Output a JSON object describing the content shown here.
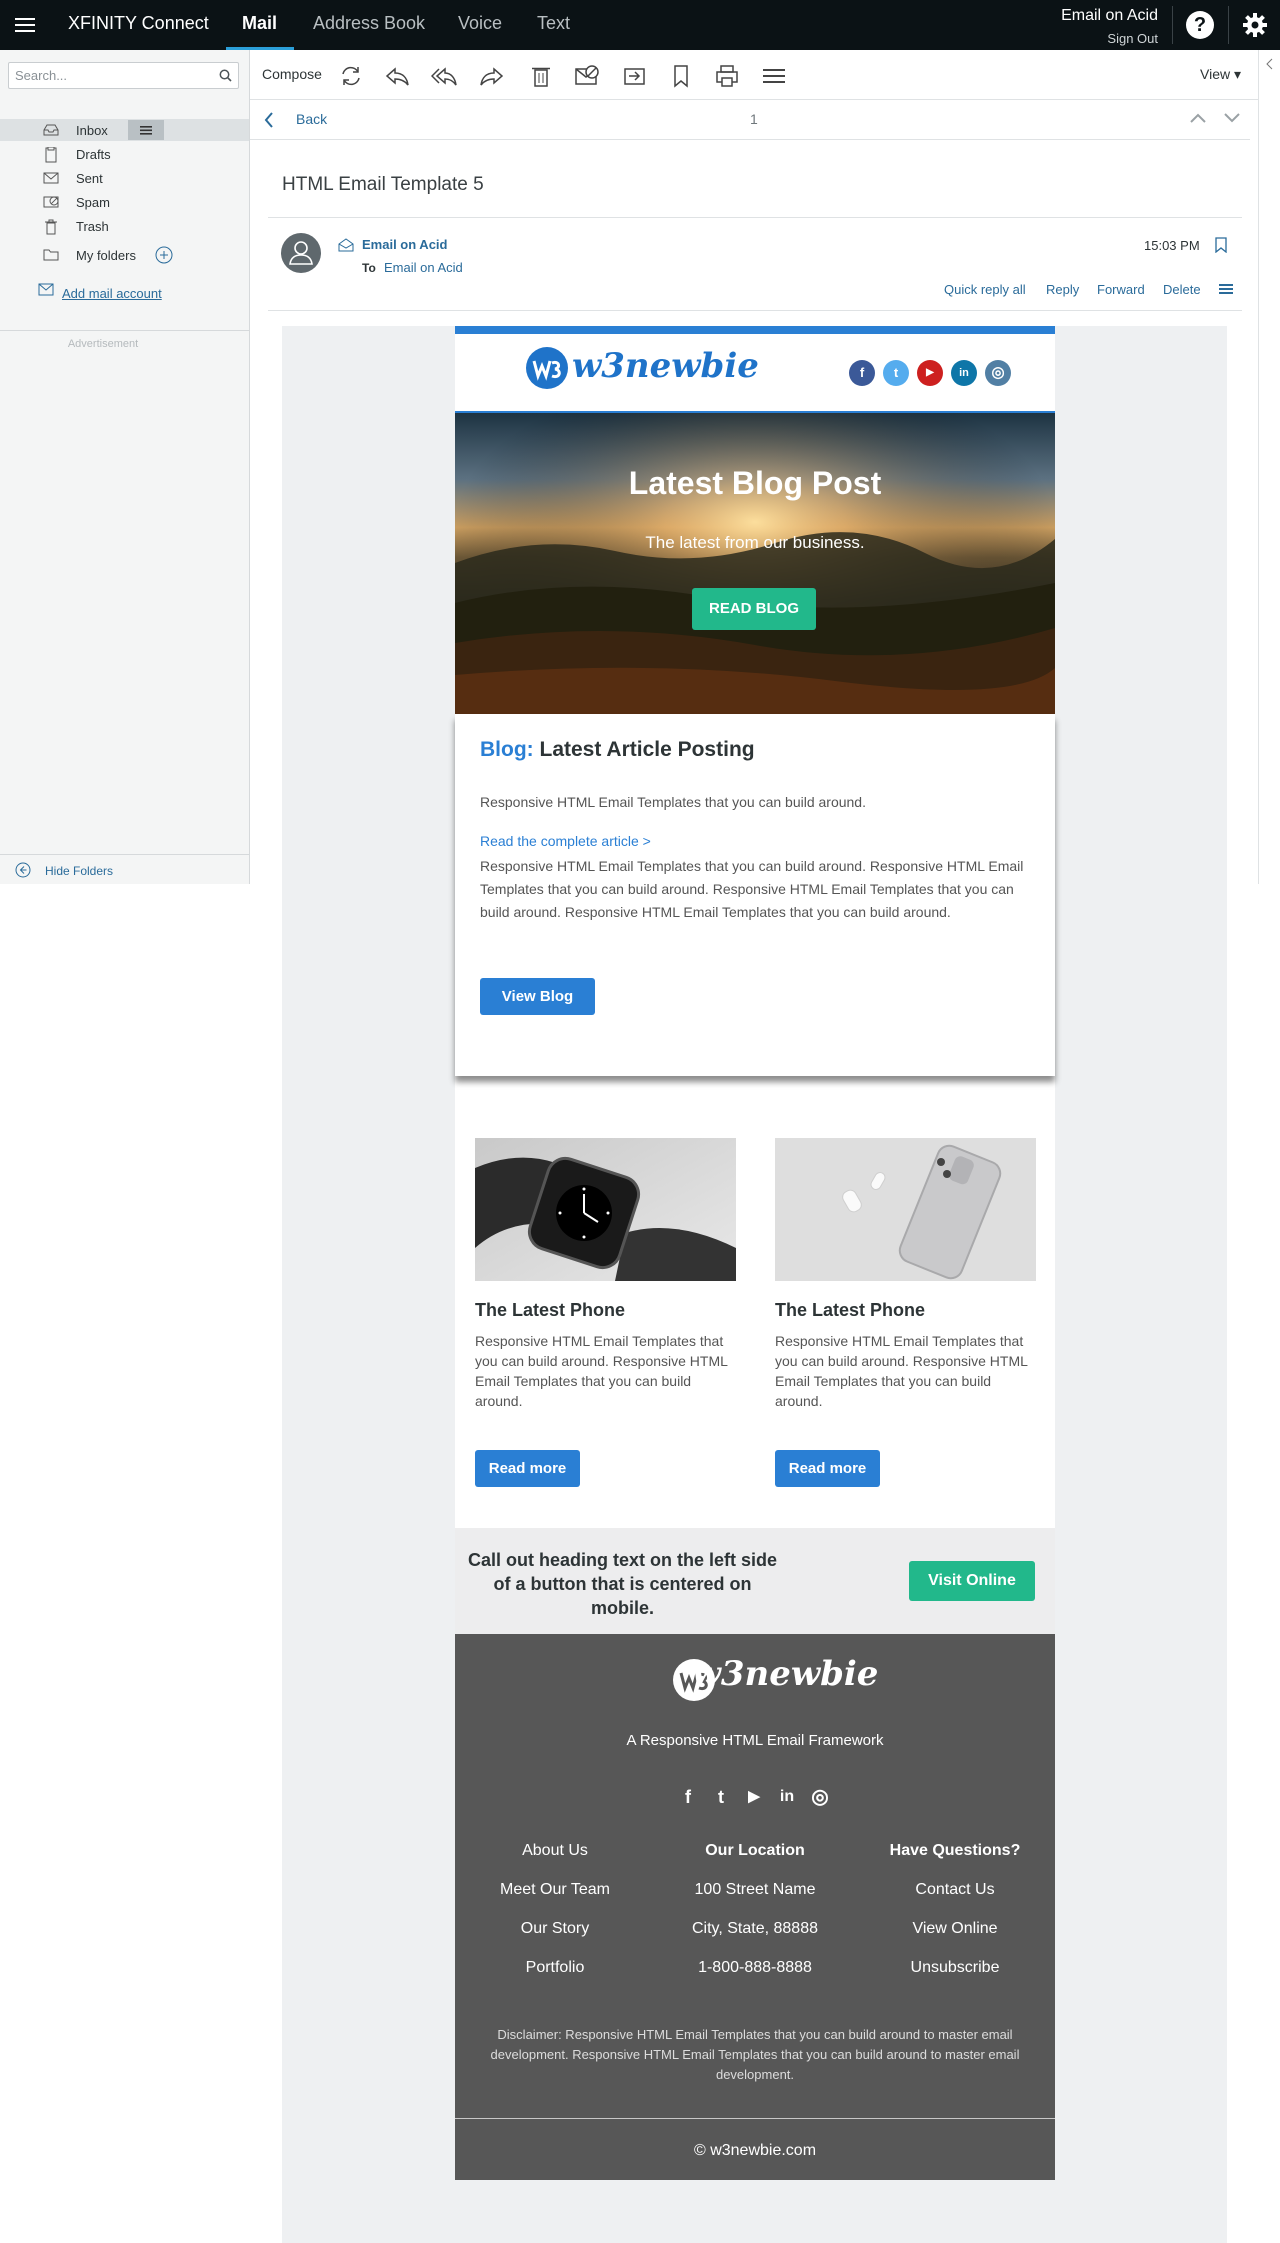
{
  "topbar": {
    "brand": "XFINITY Connect",
    "tabs": [
      "Mail",
      "Address Book",
      "Voice",
      "Text"
    ],
    "user_name": "Email on Acid",
    "sign_out": "Sign Out",
    "help_label": "?"
  },
  "sidebar": {
    "search_placeholder": "Search...",
    "folders": [
      "Inbox",
      "Drafts",
      "Sent",
      "Spam",
      "Trash"
    ],
    "my_folders": "My folders",
    "add_mail_account": "Add mail account",
    "advertisement": "Advertisement",
    "hide_folders": "Hide Folders"
  },
  "toolbar": {
    "compose": "Compose",
    "view": "View ▾",
    "icons": [
      "refresh-icon",
      "reply-icon",
      "reply-all-icon",
      "forward-icon",
      "delete-icon",
      "spam-icon",
      "move-icon",
      "bookmark-icon",
      "print-icon",
      "more-icon"
    ]
  },
  "navbar": {
    "back": "Back",
    "page": "1"
  },
  "message": {
    "subject": "HTML Email Template 5",
    "from": "Email on Acid",
    "to_label": "To",
    "to": "Email on Acid",
    "time": "15:03 PM",
    "actions": [
      "Quick reply all",
      "Reply",
      "Forward",
      "Delete"
    ]
  },
  "email": {
    "logo": "w3newbie",
    "social": [
      "f",
      "t",
      "▶",
      "in",
      "◎"
    ],
    "hero": {
      "title": "Latest Blog Post",
      "subtitle": "The latest from our business.",
      "button": "READ BLOG"
    },
    "article": {
      "title_keyword": "Blog:",
      "title_rest": "Latest Article Posting",
      "intro": "Responsive HTML Email Templates that you can build around.",
      "link": "Read the complete article >",
      "body": "Responsive HTML Email Templates that you can build around. Responsive HTML Email Templates that you can build around. Responsive HTML Email Templates that you can build around. Responsive HTML Email Templates that you can build around.",
      "button": "View Blog"
    },
    "products": [
      {
        "title": "The Latest Phone",
        "desc": "Responsive HTML Email Templates that you can build around. Responsive HTML Email Templates that you can build around.",
        "button": "Read more"
      },
      {
        "title": "The Latest Phone",
        "desc": "Responsive HTML Email Templates that you can build around. Responsive HTML Email Templates that you can build around.",
        "button": "Read more"
      }
    ],
    "callout": {
      "text": "Call out heading text on the left side of a button that is centered on mobile.",
      "button": "Visit Online"
    },
    "footer": {
      "logo": "w3newbie",
      "tagline": "A Responsive HTML Email Framework",
      "social": [
        "f",
        "t",
        "▶",
        "in",
        "◎"
      ],
      "columns": [
        {
          "items": [
            "About Us",
            "Meet Our Team",
            "Our Story",
            "Portfolio"
          ]
        },
        {
          "heading": "Our Location",
          "items": [
            "100 Street Name",
            "City, State, 88888",
            "1-800-888-8888"
          ]
        },
        {
          "heading": "Have Questions?",
          "items": [
            "Contact Us",
            "View Online",
            "Unsubscribe"
          ]
        }
      ],
      "disclaimer": "Disclaimer: Responsive HTML Email Templates that you can build around to master email development. Responsive HTML Email Templates that you can build around to master email development.",
      "copyright": "© w3newbie.com"
    }
  },
  "colors": {
    "topbar": "#0b1215",
    "accent": "#2b9fd9",
    "link": "#2a6b9a",
    "email_blue": "#2a7fd4",
    "email_green": "#22b88b",
    "footer_gray": "#575757"
  }
}
